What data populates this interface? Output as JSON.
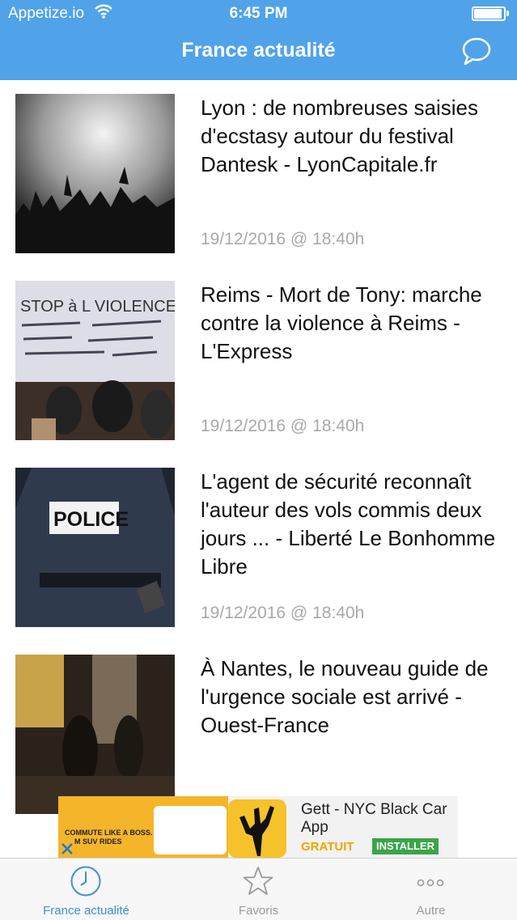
{
  "status": {
    "carrier": "Appetize.io",
    "time": "6:45 PM"
  },
  "nav": {
    "title": "France actualité"
  },
  "news": [
    {
      "title": "Lyon : de nombreuses saisies d'ecstasy autour du festival Dantesk - LyonCapitale.fr",
      "date": "19/12/2016 @ 18:40h"
    },
    {
      "title": "Reims - Mort de Tony: marche contre la violence à Reims - L'Express",
      "date": "19/12/2016 @ 18:40h"
    },
    {
      "title": "L'agent de sécurité reconnaît l'auteur des vols commis deux jours ... - Liberté Le Bonhomme Libre",
      "date": "19/12/2016 @ 18:40h"
    },
    {
      "title": "À Nantes, le nouveau guide de l'urgence sociale est arrivé - Ouest-France",
      "date": ""
    }
  ],
  "ad": {
    "tagline_1": "COMMUTE LIKE A BOSS.",
    "tagline_2": "M SUV RIDES",
    "app_name": "Gett - NYC Black Car App",
    "price": "GRATUIT",
    "install": "INSTALLER"
  },
  "tabs": [
    {
      "label": "France actualité",
      "icon": "clock-icon",
      "active": true
    },
    {
      "label": "Favoris",
      "icon": "star-icon",
      "active": false
    },
    {
      "label": "Autre",
      "icon": "more-icon",
      "active": false
    }
  ],
  "colors": {
    "nav_bg": "#50a3e9",
    "tab_active": "#3f8fd8",
    "date_gray": "#a9a9a9"
  }
}
